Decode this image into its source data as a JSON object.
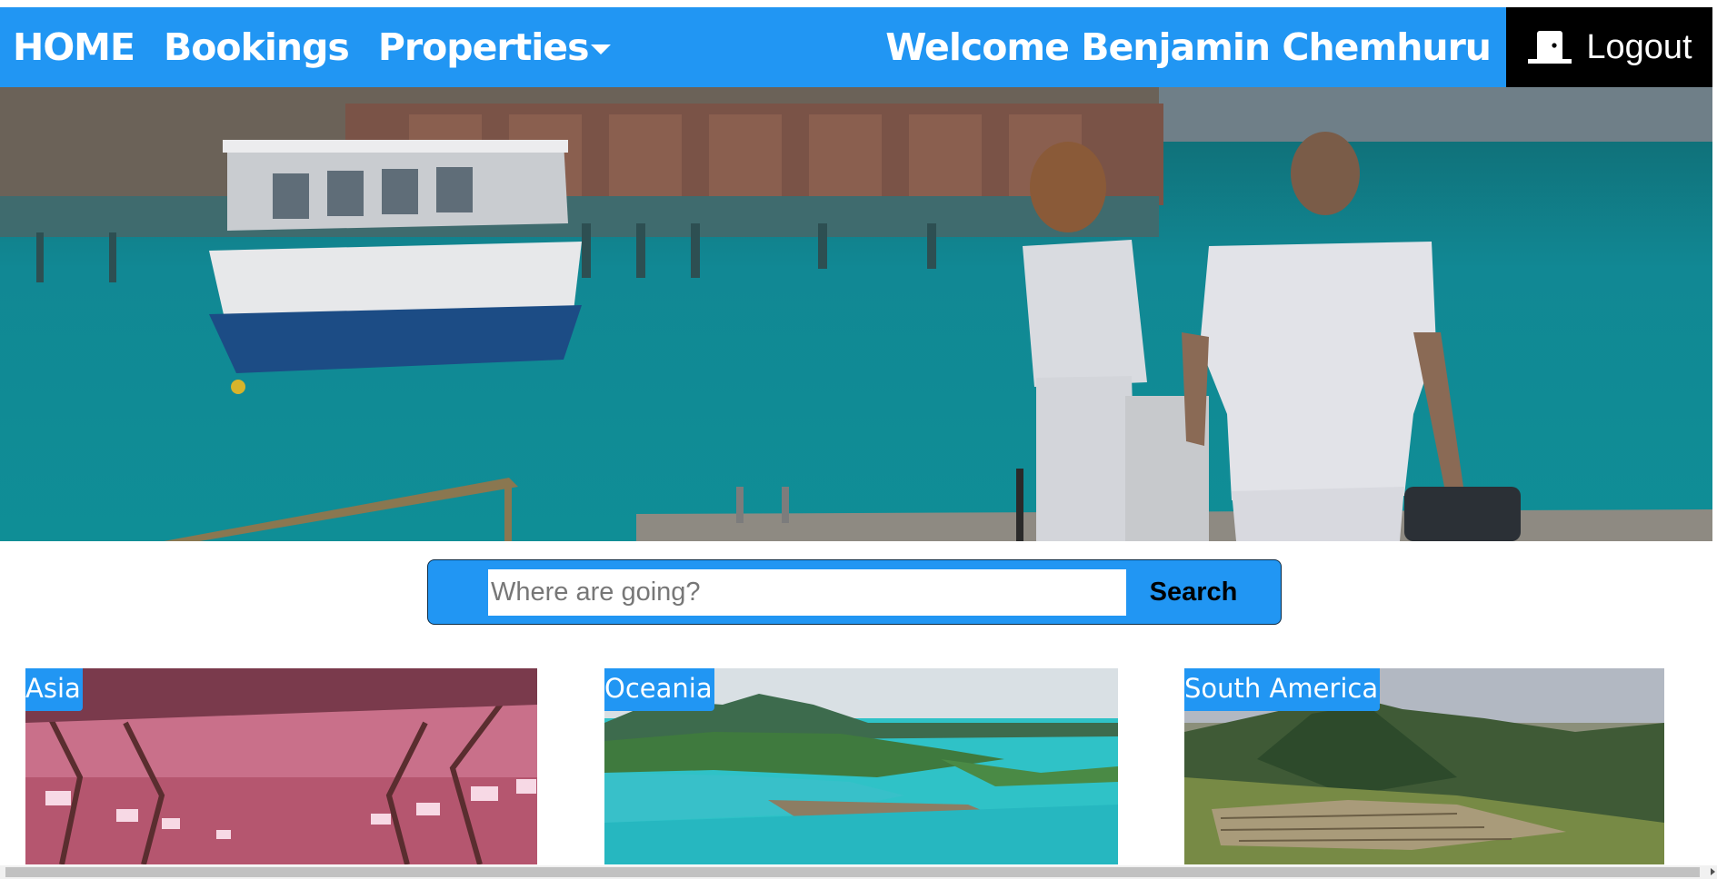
{
  "nav": {
    "home": "HOME",
    "bookings": "Bookings",
    "properties": "Properties",
    "welcome": "Welcome Benjamin Chemhuru",
    "logout": "Logout",
    "logout_icon": "door-exit-icon",
    "color": "#2196f3"
  },
  "hero": {
    "image": "couple-walking-on-pier-toward-overwater-bungalows-photo"
  },
  "search": {
    "placeholder": "Where are going?",
    "value": "",
    "button_label": "Search"
  },
  "destinations": [
    {
      "label": "Asia",
      "image": "cherry-blossom-tunnel-photo"
    },
    {
      "label": "Oceania",
      "image": "tropical-lagoon-overwater-bungalows-photo"
    },
    {
      "label": "South America",
      "image": "machu-picchu-photo"
    }
  ]
}
